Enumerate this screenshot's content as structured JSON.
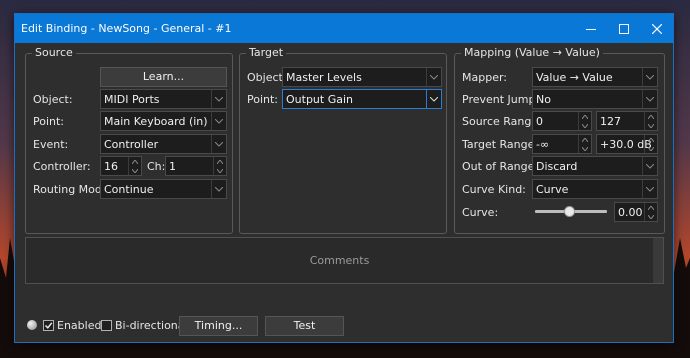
{
  "window": {
    "title": "Edit Binding - NewSong - General - #1"
  },
  "source": {
    "group_label": "Source",
    "learn_label": "Learn...",
    "object_label": "Object:",
    "object_value": "MIDI Ports",
    "point_label": "Point:",
    "point_value": "Main Keyboard (in)",
    "event_label": "Event:",
    "event_value": "Controller",
    "controller_label": "Controller:",
    "controller_value": "16",
    "ch_label": "Ch:",
    "ch_value": "1",
    "routing_label": "Routing Mode:",
    "routing_value": "Continue"
  },
  "target": {
    "group_label": "Target",
    "object_label": "Object:",
    "object_value": "Master Levels",
    "point_label": "Point:",
    "point_value": "Output Gain"
  },
  "mapping": {
    "group_label": "Mapping (Value → Value)",
    "mapper_label": "Mapper:",
    "mapper_value": "Value → Value",
    "prevent_label": "Prevent Jumps:",
    "prevent_value": "No",
    "source_range_label": "Source Range:",
    "source_min": "0",
    "source_max": "127",
    "target_range_label": "Target Range:",
    "target_min": "-∞",
    "target_max": "+30.0 dB",
    "out_of_range_label": "Out of Range:",
    "out_of_range_value": "Discard",
    "curve_kind_label": "Curve Kind:",
    "curve_kind_value": "Curve",
    "curve_label": "Curve:",
    "curve_value": "0.00",
    "curve_slider_fraction": 0.48
  },
  "comments": {
    "placeholder": "Comments"
  },
  "footer": {
    "enabled_label": "Enabled",
    "enabled_checked": true,
    "bidirectional_label": "Bi-directional",
    "bidirectional_checked": false,
    "timing_label": "Timing...",
    "test_label": "Test"
  },
  "colors": {
    "titlebar": "#0a78d7",
    "panel": "#2e2e2e",
    "focus": "#2a7fd4"
  }
}
